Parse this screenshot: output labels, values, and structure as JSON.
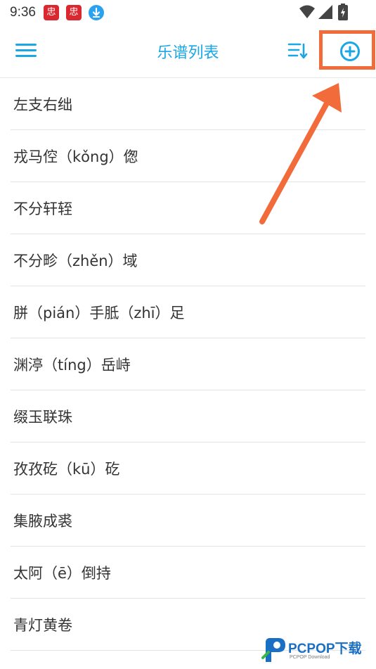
{
  "status_bar": {
    "time": "9:36",
    "app_icon_glyph": "忠",
    "icons": [
      "app-notification-icon",
      "app-notification-icon",
      "download-icon",
      "wifi-icon",
      "signal-icon",
      "battery-charging-icon"
    ]
  },
  "app_bar": {
    "title": "乐谱列表",
    "menu_icon": "menu-icon",
    "sort_icon": "sort-icon",
    "add_icon": "add-circle-icon"
  },
  "colors": {
    "accent": "#1aa7e6",
    "annotation": "#f26b3a",
    "text": "#333333",
    "divider": "#e3e3e3"
  },
  "songs": [
    {
      "title": "左支右绌"
    },
    {
      "title": "戎马倥（kǒng）偬"
    },
    {
      "title": "不分轩轾"
    },
    {
      "title": "不分畛（zhěn）域"
    },
    {
      "title": "胼（pián）手胝（zhī）足"
    },
    {
      "title": "渊渟（tíng）岳峙"
    },
    {
      "title": "缀玉联珠"
    },
    {
      "title": "孜孜矻（kū）矻"
    },
    {
      "title": "集腋成裘"
    },
    {
      "title": "太阿（ē）倒持"
    },
    {
      "title": "青灯黄卷"
    }
  ],
  "watermark": {
    "text": "PCPOP下载",
    "subtext": "PCPOP Download"
  }
}
